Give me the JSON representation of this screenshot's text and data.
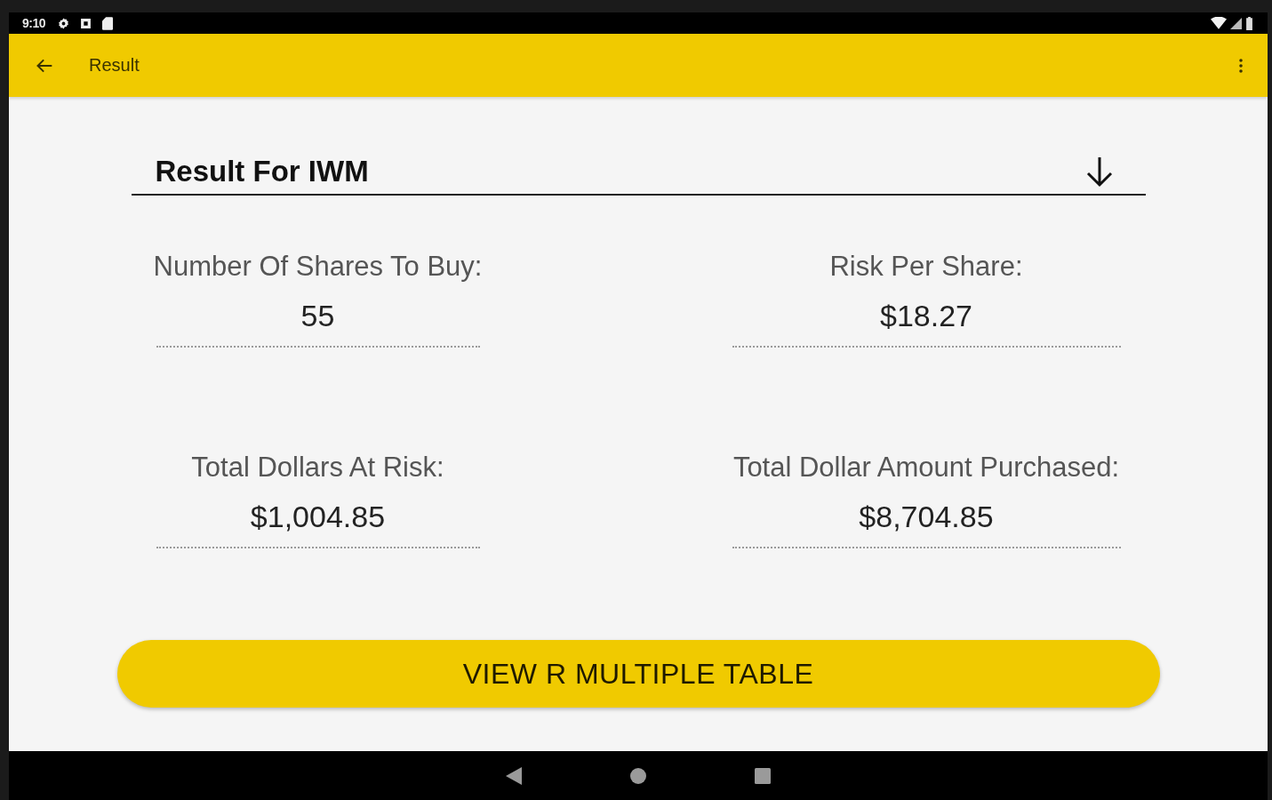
{
  "status_bar": {
    "time": "9:10"
  },
  "app_bar": {
    "title": "Result"
  },
  "result": {
    "title": "Result For IWM",
    "fields": [
      {
        "label": "Number Of Shares To Buy:",
        "value": "55"
      },
      {
        "label": "Risk Per Share:",
        "value": "$18.27"
      },
      {
        "label": "Total Dollars At Risk:",
        "value": "$1,004.85"
      },
      {
        "label": "Total Dollar Amount Purchased:",
        "value": "$8,704.85"
      }
    ]
  },
  "button": {
    "label": "VIEW R MULTIPLE TABLE"
  }
}
